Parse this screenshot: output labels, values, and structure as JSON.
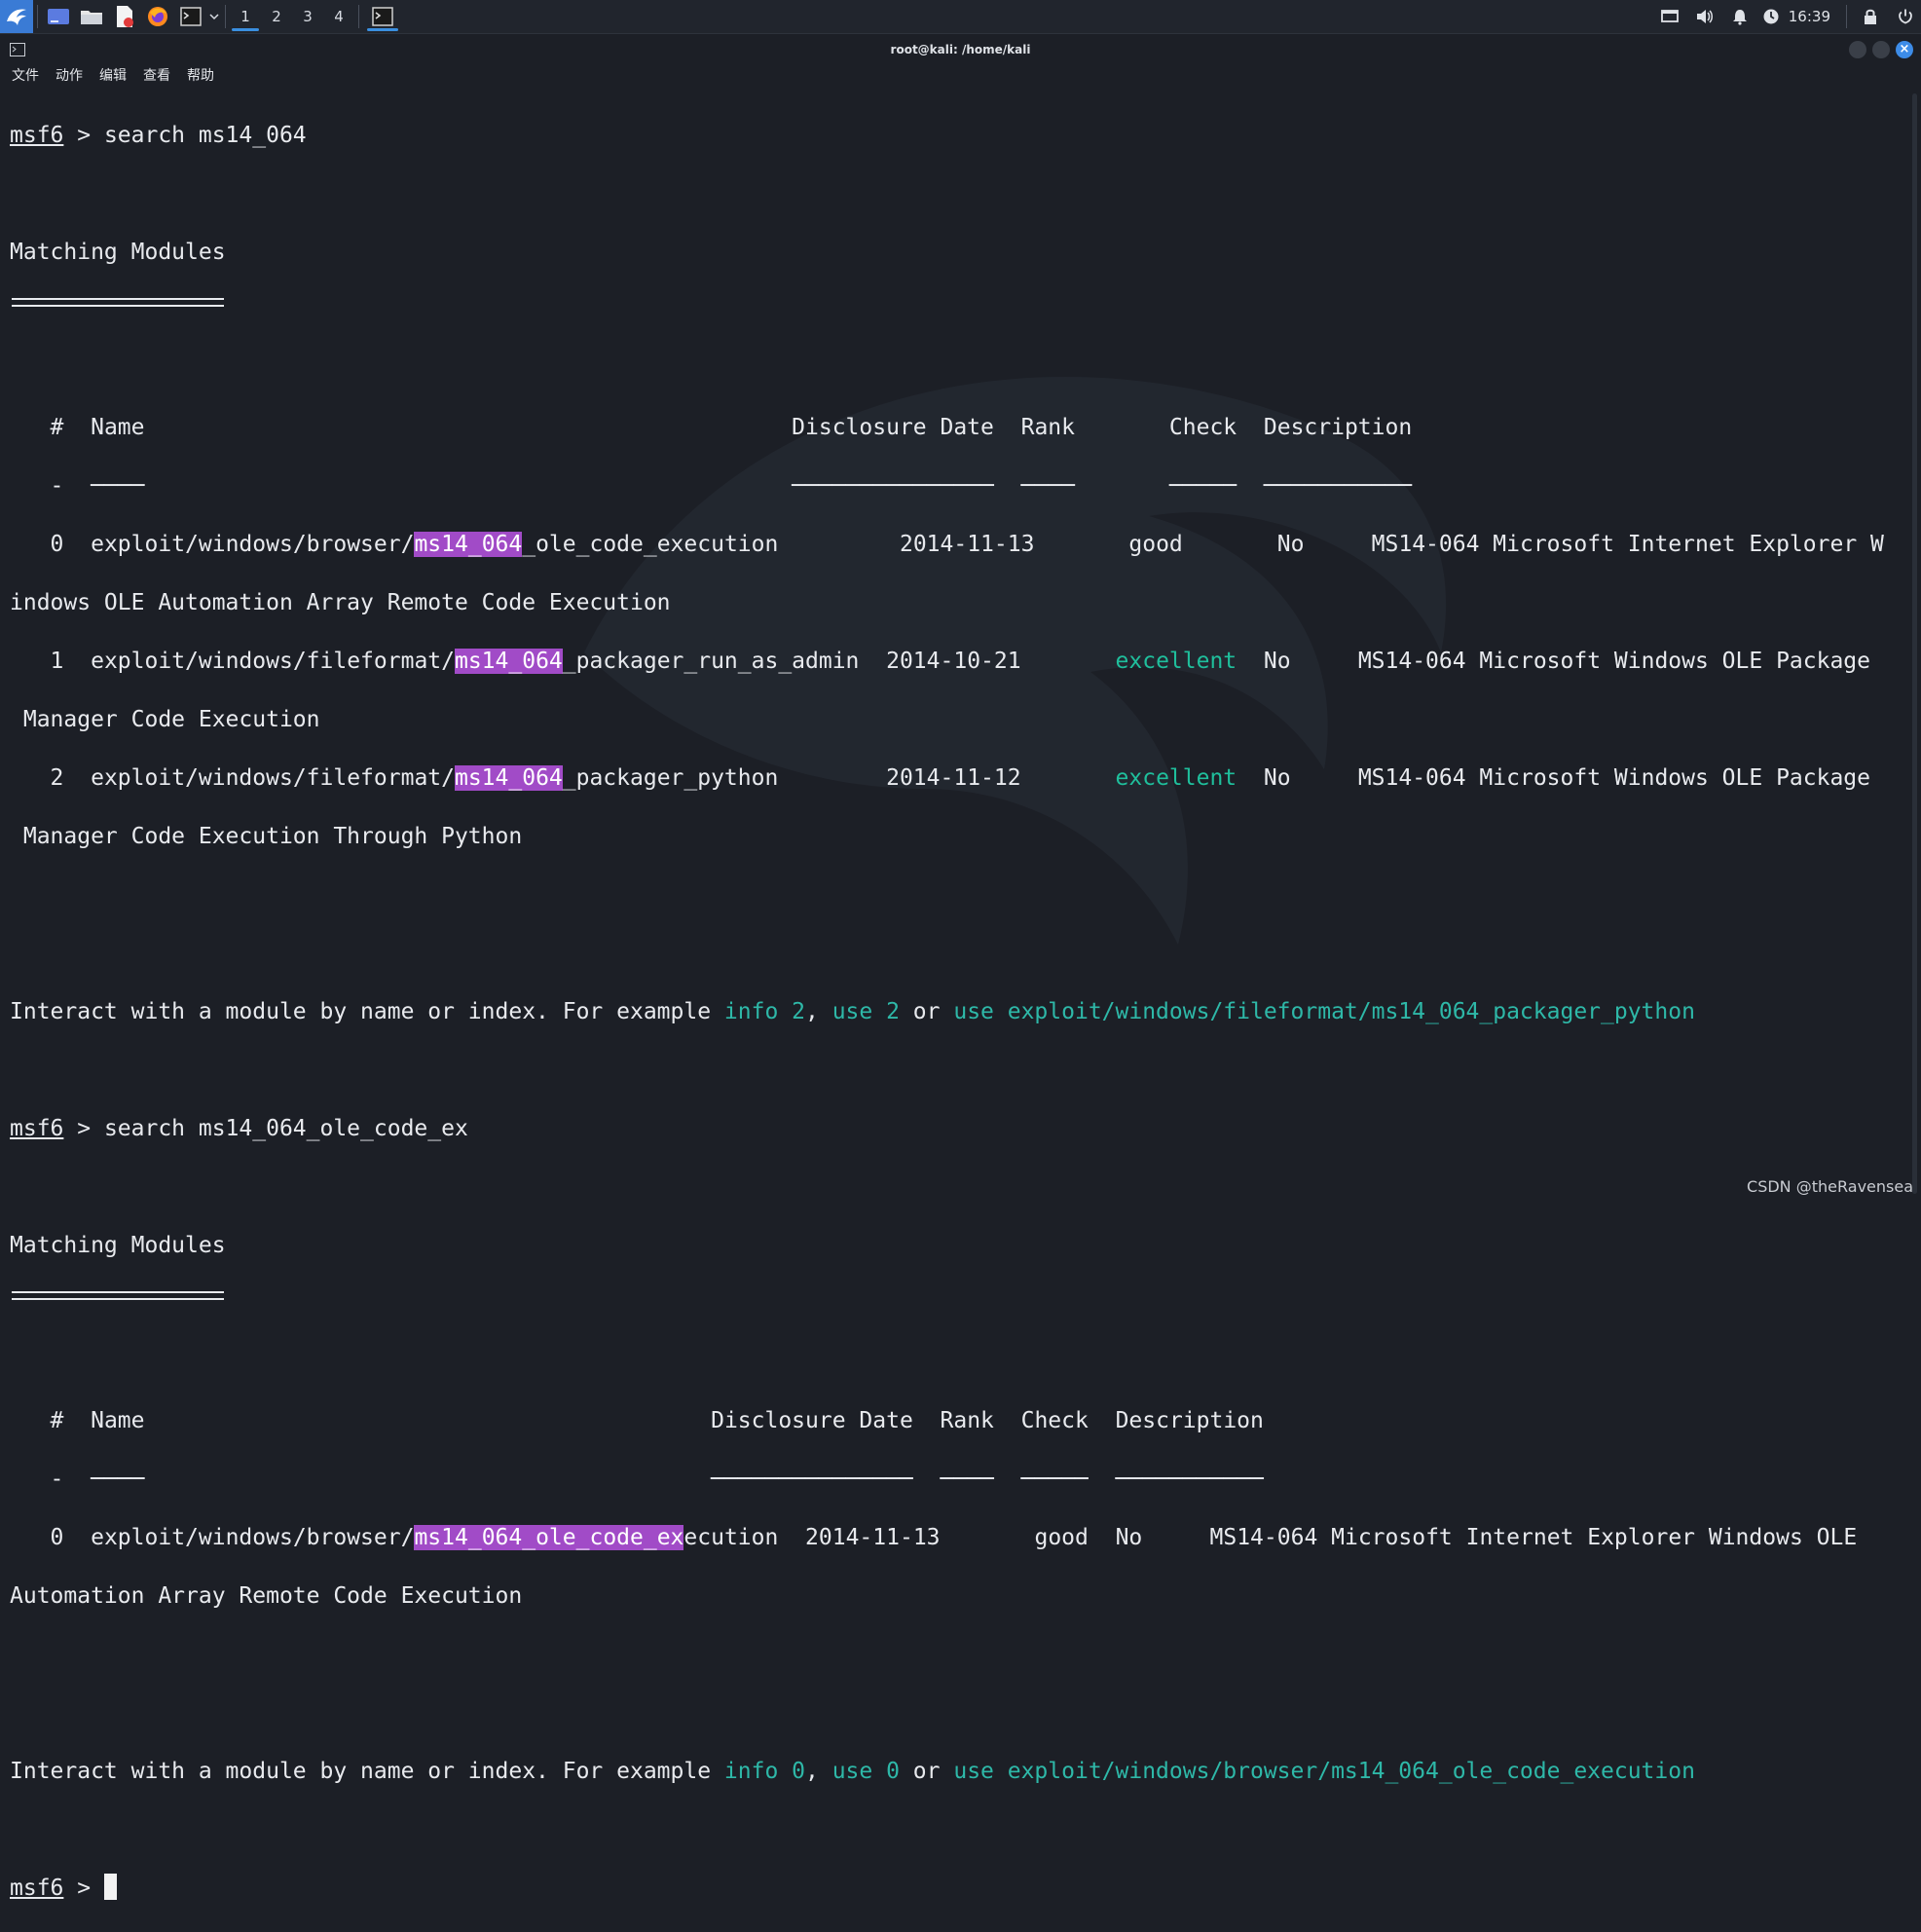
{
  "panel": {
    "workspaces": [
      "1",
      "2",
      "3",
      "4"
    ],
    "clock": "16:39"
  },
  "window": {
    "title": "root@kali: /home/kali",
    "menu": [
      "文件",
      "动作",
      "编辑",
      "查看",
      "帮助"
    ]
  },
  "terminal": {
    "prompt": "msf6",
    "cmd1": "search ms14_064",
    "cmd2": "search ms14_064_ole_code_ex",
    "matching": "Matching Modules",
    "table1": {
      "header_hash": "#",
      "header_name": "Name",
      "header_date": "Disclosure Date",
      "header_rank": "Rank",
      "header_check": "Check",
      "header_desc": "Description",
      "rows": [
        {
          "idx": "0",
          "name_pre": "exploit/windows/browser/",
          "name_hl": "ms14_064",
          "name_post": "_ole_code_execution",
          "date": "2014-11-13",
          "rank": "good",
          "check": "No",
          "desc_a": "MS14-064 Microsoft Internet Explorer W",
          "desc_b": "indows OLE Automation Array Remote Code Execution"
        },
        {
          "idx": "1",
          "name_pre": "exploit/windows/fileformat/",
          "name_hl": "ms14_064",
          "name_post": "_packager_run_as_admin",
          "date": "2014-10-21",
          "rank": "excellent",
          "check": "No",
          "desc_a": "MS14-064 Microsoft Windows OLE Package",
          "desc_b": " Manager Code Execution"
        },
        {
          "idx": "2",
          "name_pre": "exploit/windows/fileformat/",
          "name_hl": "ms14_064",
          "name_post": "_packager_python",
          "date": "2014-11-12",
          "rank": "excellent",
          "check": "No",
          "desc_a": "MS14-064 Microsoft Windows OLE Package",
          "desc_b": " Manager Code Execution Through Python"
        }
      ]
    },
    "interact1": {
      "text": "Interact with a module by name or index. For example ",
      "info": "info 2",
      "comma": ", ",
      "use": "use 2",
      "or": " or ",
      "use_full": "use exploit/windows/fileformat/ms14_064_packager_python"
    },
    "table2": {
      "rows": [
        {
          "idx": "0",
          "name_pre": "exploit/windows/browser/",
          "name_hl": "ms14_064_ole_code_ex",
          "name_post": "ecution",
          "date": "2014-11-13",
          "rank": "good",
          "check": "No",
          "desc_a": "MS14-064 Microsoft Internet Explorer Windows OLE",
          "desc_b": "Automation Array Remote Code Execution"
        }
      ]
    },
    "interact2": {
      "text": "Interact with a module by name or index. For example ",
      "info": "info 0",
      "comma": ", ",
      "use": "use 0",
      "or": " or ",
      "use_full": "use exploit/windows/browser/ms14_064_ole_code_execution"
    }
  },
  "watermark": "CSDN @theRavensea"
}
